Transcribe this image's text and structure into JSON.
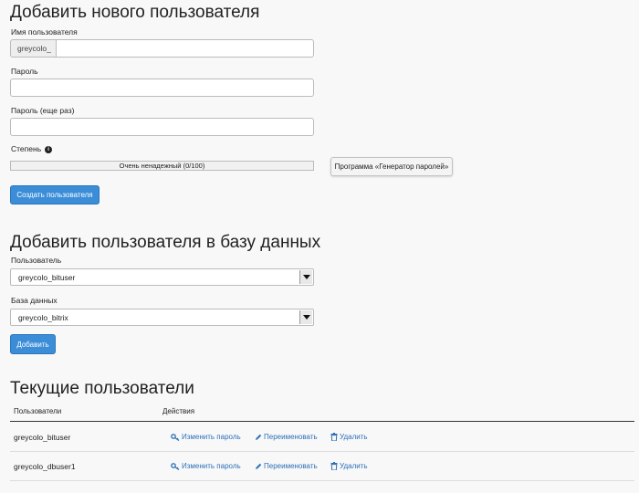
{
  "add_user": {
    "title": "Добавить нового пользователя",
    "username_label": "Имя пользователя",
    "username_prefix": "greycolo_",
    "username_value": "",
    "password_label": "Пароль",
    "password_value": "",
    "password_again_label": "Пароль (еще раз)",
    "password_again_value": "",
    "strength_label": "Степень",
    "strength_text": "Очень ненадежный (0/100)",
    "strength_value": 0,
    "generator_button": "Программа «Генератор паролей»",
    "create_button": "Создать пользователя"
  },
  "add_to_db": {
    "title": "Добавить пользователя в базу данных",
    "user_label": "Пользователь",
    "user_selected": "greycolo_bituser",
    "db_label": "База данных",
    "db_selected": "greycolo_bitrix",
    "add_button": "Добавить"
  },
  "current_users": {
    "title": "Текущие пользователи",
    "col_users": "Пользователи",
    "col_actions": "Действия",
    "rows": [
      {
        "name": "greycolo_bituser",
        "change_password": "Изменить пароль",
        "rename": "Переименовать",
        "delete": "Удалить"
      },
      {
        "name": "greycolo_dbuser1",
        "change_password": "Изменить пароль",
        "rename": "Переименовать",
        "delete": "Удалить"
      }
    ]
  },
  "colors": {
    "primary": "#3b8dd8",
    "link": "#2a6fb8",
    "background": "#f8f8f8"
  },
  "icons": {
    "strength_info": "info-icon",
    "change_password": "key-icon",
    "rename": "pencil-icon",
    "delete": "trash-icon",
    "select": "chevron-down-icon"
  }
}
